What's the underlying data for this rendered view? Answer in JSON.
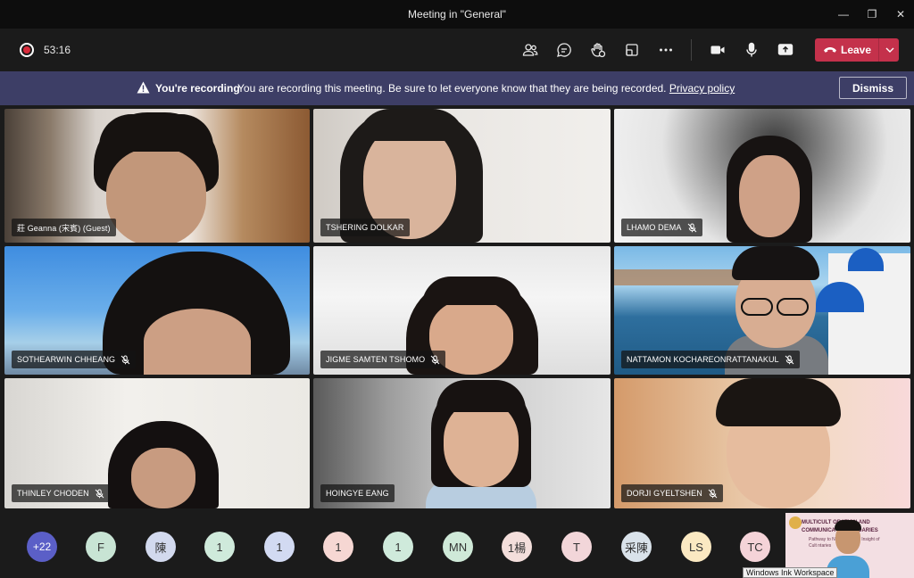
{
  "window": {
    "title": "Meeting in \"General\"",
    "minimize_label": "—",
    "maximize_label": "❐",
    "close_label": "✕"
  },
  "toolbar": {
    "timer": "53:16",
    "leave_label": "Leave",
    "icons": [
      "people-icon",
      "chat-icon",
      "raise-hand-icon",
      "rooms-icon",
      "more-icon",
      "camera-icon",
      "mic-icon",
      "share-icon"
    ]
  },
  "banner": {
    "title": "You're recording",
    "message": "You are recording this meeting. Be sure to let everyone know that they are being recorded.",
    "link": "Privacy policy",
    "dismiss": "Dismiss"
  },
  "participants": [
    {
      "name": "莊 Geanna (宋賓) (Guest)",
      "muted": false
    },
    {
      "name": "TSHERING DOLKAR",
      "muted": false
    },
    {
      "name": "LHAMO DEMA",
      "muted": true
    },
    {
      "name": "SOTHEARWIN CHHEANG",
      "muted": true
    },
    {
      "name": "JIGME SAMTEN TSHOMO",
      "muted": true
    },
    {
      "name": "NATTAMON KOCHAREONRATTANAKUL",
      "muted": true
    },
    {
      "name": "THINLEY CHODEN",
      "muted": true
    },
    {
      "name": "HOINGYE EANG",
      "muted": false
    },
    {
      "name": "DORJI GYELTSHEN",
      "muted": true
    }
  ],
  "roster": [
    {
      "label": "+22",
      "color": "#5b5fc7"
    },
    {
      "label": "F",
      "color": "#c8e4d4"
    },
    {
      "label": "陳",
      "color": "#d2d9ee"
    },
    {
      "label": "1",
      "color": "#cfeadb"
    },
    {
      "label": "1",
      "color": "#d2daf2"
    },
    {
      "label": "1",
      "color": "#f6d7d3"
    },
    {
      "label": "1",
      "color": "#cfeadb"
    },
    {
      "label": "MN",
      "color": "#cfe9d8"
    },
    {
      "label": "1楊",
      "color": "#f3dedb"
    },
    {
      "label": "T",
      "color": "#f2d6d9"
    },
    {
      "label": "采陳",
      "color": "#d9e2ea"
    },
    {
      "label": "LS",
      "color": "#fbe9c2"
    },
    {
      "label": "TC",
      "color": "#f4d3d8"
    }
  ],
  "selfview": {
    "line1": "MULTICULT    ORATION AND",
    "line2": "COMMUNICA      D BOUNDARIES",
    "line3": "Pathway to New          Narrative Insight of",
    "line4": "Cult                      ntaries"
  },
  "tooltip": "Windows Ink Workspace"
}
